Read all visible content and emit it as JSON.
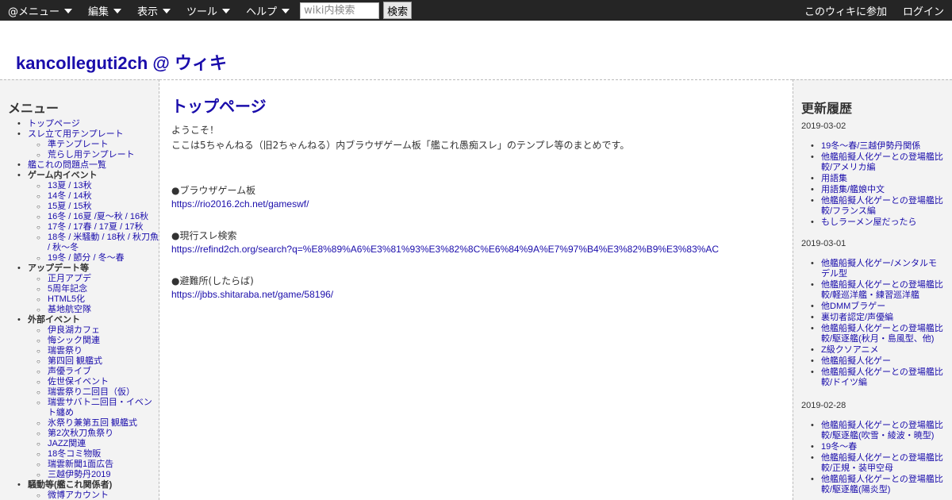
{
  "topbar": {
    "menus": [
      "@メニュー",
      "編集",
      "表示",
      "ツール",
      "ヘルプ"
    ],
    "search_placeholder": "wiki内検索",
    "search_button": "検索",
    "join": "このウィキに参加",
    "login": "ログイン"
  },
  "header": {
    "site_title": "kancolleguti2ch @ ウィキ"
  },
  "left": {
    "heading": "メニュー",
    "menu": [
      {
        "label": "トップページ",
        "link": true,
        "children": []
      },
      {
        "label": "スレ立て用テンプレート",
        "link": true,
        "children": [
          "準テンプレート",
          "荒らし用テンプレート"
        ]
      },
      {
        "label": "艦これの問題点一覧",
        "link": true,
        "children": []
      },
      {
        "label": "ゲーム内イベント",
        "link": false,
        "children": [
          "13夏 / 13秋",
          "14冬 / 14秋",
          "15夏 / 15秋",
          "16冬 / 16夏 /夏～秋 / 16秋",
          "17冬 / 17春 / 17夏 / 17秋",
          "18冬 / 米騒動 / 18秋 / 秋刀魚 / 秋〜冬",
          "19冬 / 節分 / 冬〜春"
        ]
      },
      {
        "label": "アップデート等",
        "link": false,
        "children": [
          "正月アプデ",
          "5周年記念",
          "HTML5化",
          "基地航空隊"
        ]
      },
      {
        "label": "外部イベント",
        "link": false,
        "children": [
          "伊良湖カフェ",
          "悔シック関連",
          "瑞雲祭り",
          "第四回 観艦式",
          "声優ライブ",
          "佐世保イベント",
          "瑞雲祭り二回目（仮）",
          "瑞雲サバト二回目・イベント纏め",
          "氷祭り兼第五回 観艦式",
          "第2次秋刀魚祭り",
          "JAZZ関連",
          "18冬コミ物販",
          "瑞雲新聞1面広告",
          "三越伊勢丹2019"
        ]
      },
      {
        "label": "騒動等(艦これ関係者)",
        "link": false,
        "children": [
          "微博アカウント"
        ]
      }
    ]
  },
  "main": {
    "title": "トップページ",
    "welcome": "ようこそ！",
    "intro": "ここは5ちゃんねる（旧2ちゃんねる）内ブラウザゲーム板「艦これ愚痴スレ」のテンプレ等のまとめです。",
    "sections": [
      {
        "heading": "●ブラウザゲーム板",
        "link": "https://rio2016.2ch.net/gameswf/"
      },
      {
        "heading": "●現行スレ検索",
        "link": "https://refind2ch.org/search?q=%E8%89%A6%E3%81%93%E3%82%8C%E6%84%9A%E7%97%B4%E3%82%B9%E3%83%AC"
      },
      {
        "heading": "●避難所(したらば)",
        "link": "https://jbbs.shitaraba.net/game/58196/"
      }
    ]
  },
  "right": {
    "heading": "更新履歴",
    "history": [
      {
        "date": "2019-03-02",
        "items": [
          "19冬〜春/三越伊勢丹関係",
          "他艦船擬人化ゲーとの登場艦比較/アメリカ編",
          "用語集",
          "用語集/艦娘中文",
          "他艦船擬人化ゲーとの登場艦比較/フランス編",
          "もしラーメン屋だったら"
        ]
      },
      {
        "date": "2019-03-01",
        "items": [
          "他艦船擬人化ゲー/メンタルモデル型",
          "他艦船擬人化ゲーとの登場艦比較/軽巡洋艦・練習巡洋艦",
          "他DMMブラゲー",
          "裏切者認定/声優編",
          "他艦船擬人化ゲーとの登場艦比較/駆逐艦(秋月・島風型、他)",
          "Z級クソアニメ",
          "他艦船擬人化ゲー",
          "他艦船擬人化ゲーとの登場艦比較/ドイツ編"
        ]
      },
      {
        "date": "2019-02-28",
        "items": [
          "他艦船擬人化ゲーとの登場艦比較/駆逐艦(吹雪・綾波・暁型)",
          "19冬〜春",
          "他艦船擬人化ゲーとの登場艦比較/正規・装甲空母",
          "他艦船擬人化ゲーとの登場艦比較/駆逐艦(陽炎型)"
        ]
      }
    ]
  }
}
